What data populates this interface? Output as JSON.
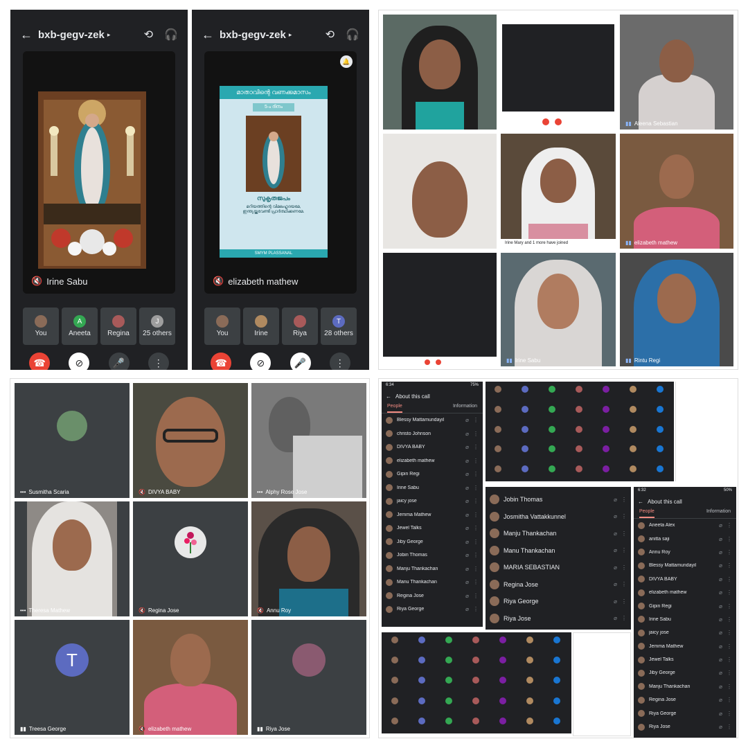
{
  "phone1": {
    "meeting_code": "bxb-gegv-zek",
    "stage_name": "Irine Sabu",
    "thumbs": [
      {
        "label": "You",
        "color": "#8a6b58"
      },
      {
        "label": "Aneeta",
        "initial": "A",
        "color": "#34a853"
      },
      {
        "label": "Regina",
        "color": "#a85a5a"
      },
      {
        "label": "25 others",
        "initial": "J",
        "color": "#9e9e9e"
      }
    ]
  },
  "phone2": {
    "meeting_code": "bxb-gegv-zek",
    "stage_name": "elizabeth mathew",
    "poster": {
      "title": "മാതാവിന്റെ വണക്കമാസം",
      "day": "5-ം ദിനം",
      "prayer_title": "സുകൃതജപം",
      "prayer_line1": "മറിയത്തിന്റെ വിമലഹൃദയമേ,",
      "prayer_line2": "ഇന്ത്യയ്ക്കുവേണ്ടി പ്രാർത്ഥിക്കണമേ.",
      "footer": "SMYM PLASSANAL"
    },
    "thumbs": [
      {
        "label": "You",
        "color": "#8a6b58"
      },
      {
        "label": "Irine",
        "color": "#b08a60"
      },
      {
        "label": "Riya",
        "color": "#a85a5a"
      },
      {
        "label": "28 others",
        "initial": "T",
        "color": "#5c6bc0"
      }
    ]
  },
  "q2_tiles": [
    {
      "label": ""
    },
    {
      "label": ""
    },
    {
      "label": "Aleena Sebastian"
    },
    {
      "label": ""
    },
    {
      "label": "Irine Mary and 1 more have joined"
    },
    {
      "label": "elizabeth mathew"
    },
    {
      "label": ""
    },
    {
      "label": "Irine Sabu"
    },
    {
      "label": "Rintu Regi"
    }
  ],
  "q3_tiles": [
    {
      "label": "Susmitha Scaria"
    },
    {
      "label": "DIVYA BABY"
    },
    {
      "label": "Alphy Rose Jose"
    },
    {
      "label": "Theresa Mathew"
    },
    {
      "label": "Regina Jose"
    },
    {
      "label": "Annu Roy"
    },
    {
      "label": "Treesa George",
      "initial": "T"
    },
    {
      "label": "elizabeth mathew"
    },
    {
      "label": "Riya Jose"
    }
  ],
  "list1": {
    "time": "6:34",
    "battery": "75%",
    "title": "About this call",
    "tab_people": "People",
    "tab_info": "Information",
    "people": [
      "Blessy Mattamundayil",
      "christo Johnson",
      "DIVYA BABY",
      "elizabeth mathew",
      "Gipin Regi",
      "Irine Sabu",
      "jaicy jose",
      "Jemma Mathew",
      "Jewel Talks",
      "Jiby George",
      "Jobin Thomas",
      "Manju Thankachan",
      "Manu Thankachan",
      "Regina Jose",
      "Riya George"
    ]
  },
  "list2": {
    "people": [
      "Jobin Thomas",
      "Josmitha Vattakkunnel",
      "Manju Thankachan",
      "Manu Thankachan",
      "MARIA SEBASTIAN",
      "Regina Jose",
      "Riya George",
      "Riya Jose"
    ]
  },
  "list3": {
    "time": "6:32",
    "battery": "50%",
    "title": "About this call",
    "tab_people": "People",
    "tab_info": "Information",
    "people": [
      "Aneeta Alex",
      "anitta saji",
      "Annu Roy",
      "Blessy Mattamundayil",
      "DIVYA BABY",
      "elizabeth mathew",
      "Gipin Regi",
      "Irine Sabu",
      "jaicy jose",
      "Jemma Mathew",
      "Jewel Talks",
      "Jiby George",
      "Manju Thankachan",
      "Regina Jose",
      "Riya George",
      "Riya Jose"
    ]
  },
  "icons": {
    "back": "←",
    "mic_off": "🎙",
    "more": "⋮"
  }
}
